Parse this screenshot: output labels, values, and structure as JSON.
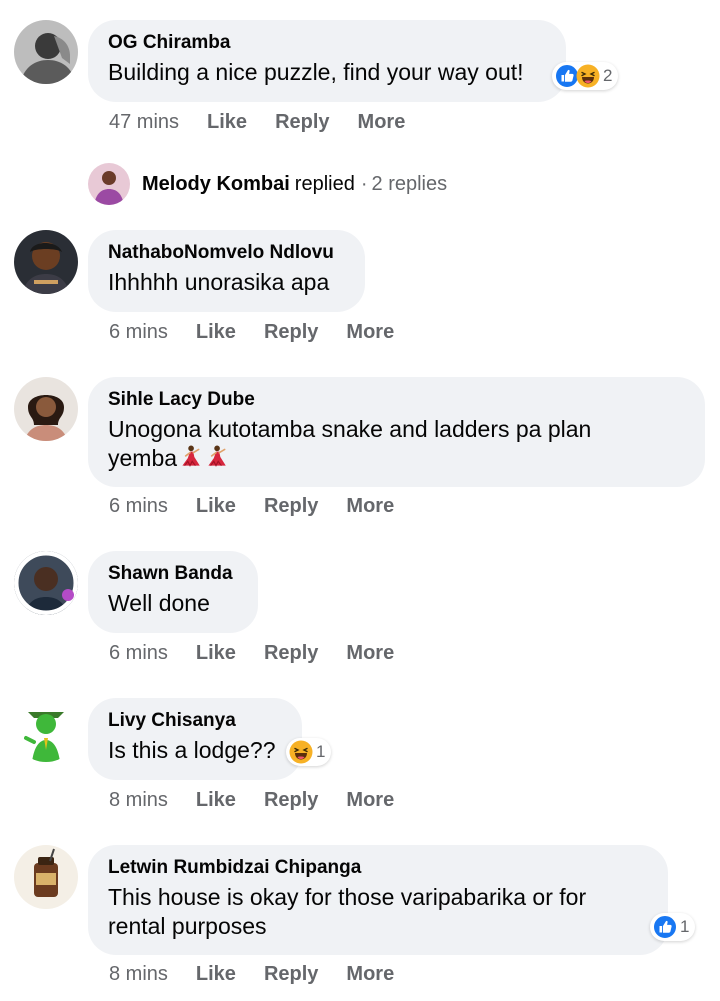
{
  "comments": [
    {
      "author": "OG Chiramba",
      "text": "Building a nice puzzle, find your way out!",
      "time": "47 mins",
      "reaction_count": "2",
      "reactions": [
        "like-icon",
        "haha-icon"
      ]
    },
    {
      "author": "NathaboNomvelo Ndlovu",
      "text": "Ihhhhh unorasika apa",
      "time": "6 mins"
    },
    {
      "author": "Sihle Lacy Dube",
      "text_line1": "Unogona kutotamba snake and ladders pa plan",
      "text_line2": "yemba",
      "emojis": [
        "dancer-emoji",
        "dancer-emoji"
      ],
      "time": "6 mins"
    },
    {
      "author": "Shawn Banda",
      "text": "Well done",
      "time": "6 mins"
    },
    {
      "author": "Livy Chisanya",
      "text": "Is this a lodge??",
      "time": "8 mins",
      "reaction_count": "1",
      "reactions": [
        "haha-icon"
      ]
    },
    {
      "author": "Letwin Rumbidzai Chipanga",
      "text_line1": "This house is okay for those varipabarika or for",
      "text_line2": "rental purposes",
      "time": "8 mins",
      "reaction_count": "1",
      "reactions": [
        "like-icon"
      ]
    }
  ],
  "replies": {
    "name": "Melody Kombai",
    "verb": "replied",
    "sep": "·",
    "count": "2 replies"
  },
  "actions": {
    "like": "Like",
    "reply": "Reply",
    "more": "More"
  },
  "colors": {
    "bubble": "#f0f2f5",
    "meta": "#65676b",
    "like_blue": "#1877f2",
    "haha_yellow": "#f7b125"
  }
}
